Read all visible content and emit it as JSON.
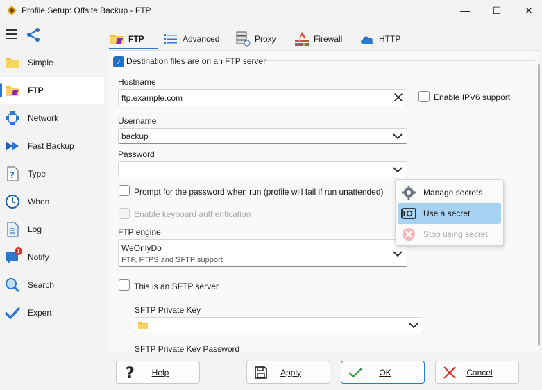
{
  "window": {
    "title": "Profile Setup: Offsite Backup - FTP",
    "minimize": "—",
    "maximize": "☐",
    "close": "✕"
  },
  "sidebar": {
    "items": [
      {
        "label": "Simple",
        "icon": "folder-icon"
      },
      {
        "label": "FTP",
        "icon": "ftp-folder-icon"
      },
      {
        "label": "Network",
        "icon": "network-icon"
      },
      {
        "label": "Fast Backup",
        "icon": "fast-forward-icon"
      },
      {
        "label": "Type",
        "icon": "document-question-icon"
      },
      {
        "label": "When",
        "icon": "clock-icon"
      },
      {
        "label": "Log",
        "icon": "log-icon"
      },
      {
        "label": "Notify",
        "icon": "chat-notify-icon"
      },
      {
        "label": "Search",
        "icon": "search-icon"
      },
      {
        "label": "Expert",
        "icon": "checkmark-icon"
      }
    ],
    "notify_badge": "1"
  },
  "tabs": [
    {
      "label": "FTP",
      "icon": "ftp-folder-icon"
    },
    {
      "label": "Advanced",
      "icon": "list-icon"
    },
    {
      "label": "Proxy",
      "icon": "proxy-server-icon"
    },
    {
      "label": "Firewall",
      "icon": "firewall-icon"
    },
    {
      "label": "HTTP",
      "icon": "cloud-icon"
    }
  ],
  "form": {
    "ftp_server_label": "Destination files are on an FTP server",
    "hostname_label": "Hostname",
    "hostname_value": "ftp.example.com",
    "ipv6_label": "Enable IPV6 support",
    "username_label": "Username",
    "username_value": "backup",
    "password_label": "Password",
    "password_value": "",
    "prompt_label": "Prompt for the password when run (profile will fail if run unattended)",
    "keyboard_auth_label": "Enable keyboard authentication",
    "engine_label": "FTP engine",
    "engine_value": "WeOnlyDo",
    "engine_desc": "FTP, FTPS and SFTP support",
    "sftp_label": "This is an SFTP server",
    "sftp_key_label": "SFTP Private Key",
    "sftp_key_pw_label": "SFTP Private Key Password"
  },
  "context_menu": {
    "items": [
      {
        "label": "Manage secrets",
        "icon": "gear-icon"
      },
      {
        "label": "Use a secret",
        "icon": "safe-icon"
      },
      {
        "label": "Stop using secret",
        "icon": "stop-icon"
      }
    ]
  },
  "buttons": {
    "help": "Help",
    "apply": "Apply",
    "ok": "OK",
    "cancel": "Cancel"
  },
  "colors": {
    "accent": "#2b78d0",
    "highlight": "#a7d2f2"
  }
}
